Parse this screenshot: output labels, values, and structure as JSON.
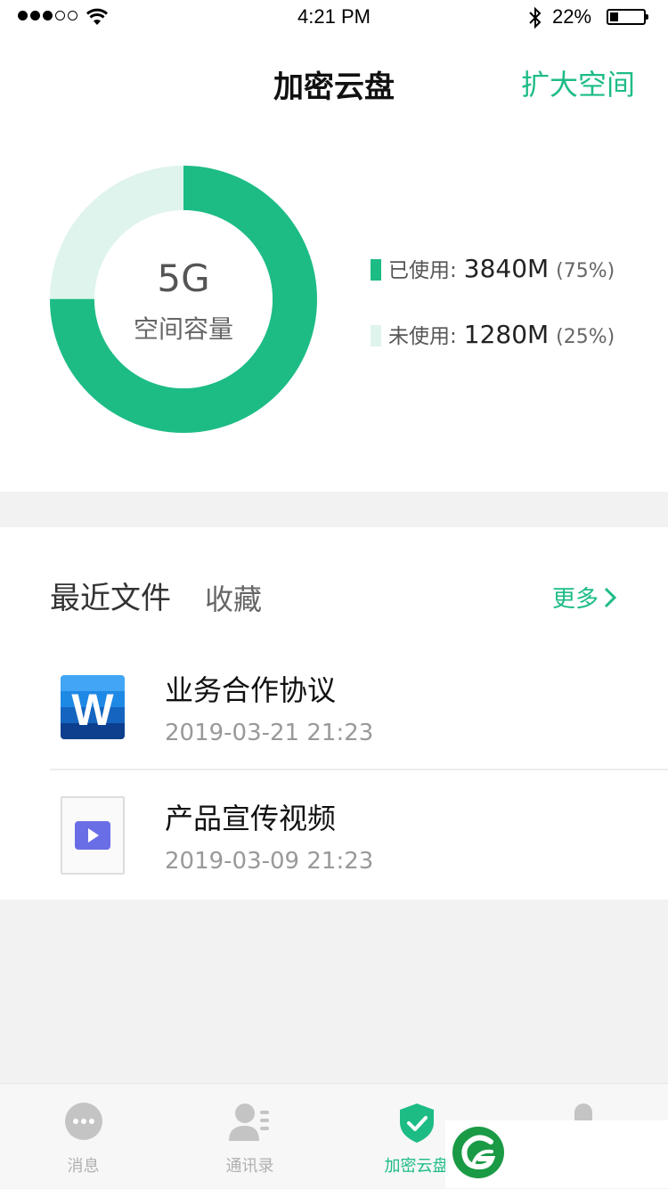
{
  "status_bar": {
    "time": "4:21 PM",
    "battery": "22%",
    "signal_bars": 3,
    "signal_total": 5,
    "battery_level": 0.22
  },
  "header": {
    "title": "加密云盘",
    "action_label": "扩大空间"
  },
  "storage": {
    "total": "5G",
    "caption": "空间容量",
    "accent_color": "#1dbc85",
    "free_color": "#dff4ec",
    "used": {
      "label": "已使用:",
      "value": "3840M",
      "percent_text": "(75%)",
      "fraction": 0.75
    },
    "free": {
      "label": "未使用:",
      "value": "1280M",
      "percent_text": "(25%)",
      "fraction": 0.25
    }
  },
  "files_section": {
    "tabs": [
      "最近文件",
      "收藏"
    ],
    "more_label": "更多",
    "files": [
      {
        "name": "业务合作协议",
        "date": "2019-03-21 21:23",
        "icon": "word-doc-icon"
      },
      {
        "name": "产品宣传视频",
        "date": "2019-03-09 21:23",
        "icon": "video-file-icon"
      }
    ]
  },
  "tab_bar": {
    "items": [
      {
        "label": "消息",
        "icon": "chat-bubble-icon",
        "active": false
      },
      {
        "label": "通讯录",
        "icon": "contacts-icon",
        "active": false
      },
      {
        "label": "加密云盘",
        "icon": "shield-check-icon",
        "active": true
      },
      {
        "label": "",
        "icon": "profile-icon",
        "active": false
      }
    ]
  }
}
